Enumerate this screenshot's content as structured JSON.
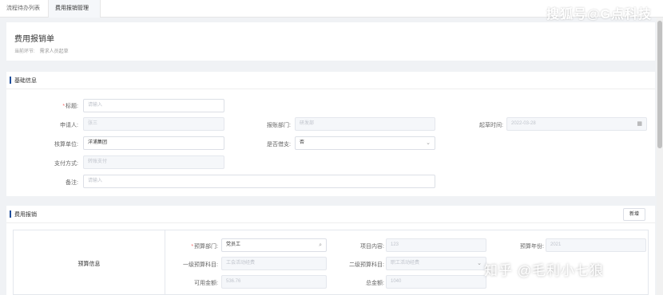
{
  "tabs": [
    {
      "label": "流程待办列表"
    },
    {
      "label": "费用报销管理",
      "close": "×"
    }
  ],
  "watermarks": {
    "top": "搜狐号@G点科技",
    "bottom": "知乎 @毛利小七狼"
  },
  "header": {
    "title": "费用报销单",
    "crumb_label": "当前环节:",
    "crumb_value": "需求人员起草"
  },
  "basic": {
    "section_title": "基础信息",
    "fields": {
      "title": {
        "label": "标题:",
        "required": "*",
        "placeholder": "请输入"
      },
      "applicant": {
        "label": "申请人:",
        "value": "张三"
      },
      "dept": {
        "label": "报账部门:",
        "value": "研发部"
      },
      "date": {
        "label": "起草时间:",
        "value": "2022-03-28"
      },
      "unit": {
        "label": "核算单位:",
        "value": "洋浦集团"
      },
      "loan": {
        "label": "是否借支:",
        "value": "否"
      },
      "pay": {
        "label": "支付方式:",
        "value": "转账支付"
      },
      "remark": {
        "label": "备注:",
        "placeholder": "请输入"
      }
    }
  },
  "expense": {
    "section_title": "费用报销",
    "new_button": "新增",
    "row_label": "预算信息",
    "fields": {
      "budget_dept": {
        "label": "预算部门:",
        "required": "*",
        "value": "党员工"
      },
      "project": {
        "label": "项目内容:",
        "value": "123"
      },
      "budget_year": {
        "label": "预算年份:",
        "value": "2021"
      },
      "subject1": {
        "label": "一级预算科目:",
        "value": "工会活动经费"
      },
      "subject2": {
        "label": "二级预算科目:",
        "value": "职工活动经费"
      },
      "avail": {
        "label": "可用金额:",
        "value": "536.76"
      },
      "total": {
        "label": "总金额:",
        "value": "1040"
      }
    }
  },
  "icons": {
    "search": "search-icon",
    "calendar": "calendar-icon",
    "chevron": "chevron-down-icon"
  },
  "colors": {
    "accent": "#1f4e9c",
    "required": "#f56c6c"
  }
}
